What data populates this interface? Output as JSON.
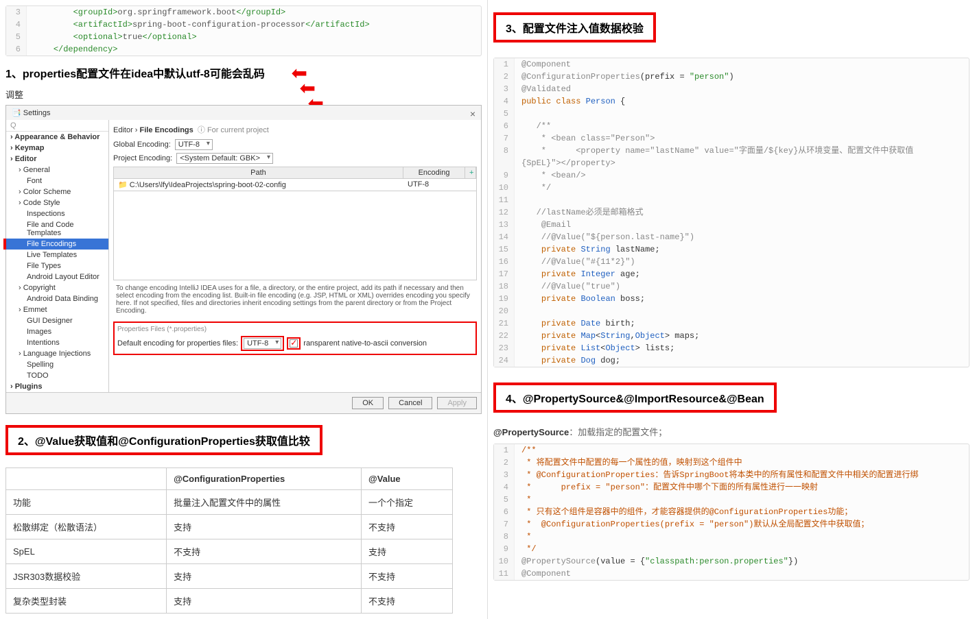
{
  "left": {
    "code1": [
      {
        "n": 3,
        "html": "        <span class='t-tag'>&lt;groupId&gt;</span><span class='t-text'>org.springframework.boot</span><span class='t-tag'>&lt;/groupId&gt;</span>"
      },
      {
        "n": 4,
        "html": "        <span class='t-tag'>&lt;artifactId&gt;</span><span class='t-text'>spring-boot-configuration-processor</span><span class='t-tag'>&lt;/artifactId&gt;</span>"
      },
      {
        "n": 5,
        "html": "        <span class='t-tag'>&lt;optional&gt;</span><span class='t-text'>true</span><span class='t-tag'>&lt;/optional&gt;</span>"
      },
      {
        "n": 6,
        "html": "    <span class='t-tag'>&lt;/dependency&gt;</span>"
      }
    ],
    "h1": "1、properties配置文件在idea中默认utf-8可能会乱码",
    "adjust": "调整",
    "settings": {
      "title": "Settings",
      "search_ph": "Q",
      "tree": [
        {
          "lvl": 1,
          "label": "Appearance & Behavior"
        },
        {
          "lvl": 1,
          "label": "Keymap"
        },
        {
          "lvl": 1,
          "label": "Editor",
          "open": true
        },
        {
          "lvl": 2,
          "label": "General"
        },
        {
          "lvl": 3,
          "label": "Font"
        },
        {
          "lvl": 2,
          "label": "Color Scheme"
        },
        {
          "lvl": 2,
          "label": "Code Style"
        },
        {
          "lvl": 3,
          "label": "Inspections"
        },
        {
          "lvl": 3,
          "label": "File and Code Templates"
        },
        {
          "lvl": 3,
          "label": "File Encodings",
          "sel": true
        },
        {
          "lvl": 3,
          "label": "Live Templates"
        },
        {
          "lvl": 3,
          "label": "File Types"
        },
        {
          "lvl": 3,
          "label": "Android Layout Editor"
        },
        {
          "lvl": 2,
          "label": "Copyright"
        },
        {
          "lvl": 3,
          "label": "Android Data Binding"
        },
        {
          "lvl": 2,
          "label": "Emmet"
        },
        {
          "lvl": 3,
          "label": "GUI Designer"
        },
        {
          "lvl": 3,
          "label": "Images"
        },
        {
          "lvl": 3,
          "label": "Intentions"
        },
        {
          "lvl": 2,
          "label": "Language Injections"
        },
        {
          "lvl": 3,
          "label": "Spelling"
        },
        {
          "lvl": 3,
          "label": "TODO"
        },
        {
          "lvl": 1,
          "label": "Plugins"
        }
      ],
      "crumb_editor": "Editor",
      "crumb_fe": "File Encodings",
      "crumb_scope": "For current project",
      "global_label": "Global Encoding:",
      "global_val": "UTF-8",
      "project_label": "Project Encoding:",
      "project_val": "<System Default: GBK>",
      "path_hdr": "Path",
      "enc_hdr": "Encoding",
      "path_val": "C:\\Users\\lfy\\IdeaProjects\\spring-boot-02-config",
      "enc_val": "UTF-8",
      "desc": "To change encoding IntelliJ IDEA uses for a file, a directory, or the entire project, add its path if necessary and then select encoding from the encoding list. Built-in file encoding (e.g. JSP, HTML or XML) overrides encoding you specify here. If not specified, files and directories inherit encoding settings from the parent directory or from the Project Encoding.",
      "prop_hdr": "Properties Files (*.properties)",
      "prop_label": "Default encoding for properties files:",
      "prop_val": "UTF-8",
      "prop_check": "ransparent native-to-ascii conversion",
      "ok": "OK",
      "cancel": "Cancel",
      "apply": "Apply"
    },
    "h2": "2、@Value获取值和@ConfigurationProperties获取值比较",
    "table": {
      "head": [
        "",
        "@ConfigurationProperties",
        "@Value"
      ],
      "rows": [
        [
          "功能",
          "批量注入配置文件中的属性",
          "一个个指定"
        ],
        [
          "松散绑定（松散语法）",
          "支持",
          "不支持"
        ],
        [
          "SpEL",
          "不支持",
          "支持"
        ],
        [
          "JSR303数据校验",
          "支持",
          "不支持"
        ],
        [
          "复杂类型封装",
          "支持",
          "不支持"
        ]
      ]
    }
  },
  "right": {
    "h3": "3、配置文件注入值数据校验",
    "code2": [
      {
        "n": 1,
        "html": "<span class='t-anno'>@Component</span>"
      },
      {
        "n": 2,
        "html": "<span class='t-anno'>@ConfigurationProperties</span>(prefix = <span class='t-str'>\"person\"</span>)"
      },
      {
        "n": 3,
        "html": "<span class='t-anno'>@Validated</span>"
      },
      {
        "n": 4,
        "html": "<span class='t-kw'>public</span> <span class='t-kw'>class</span> <span class='t-class'>Person</span> {"
      },
      {
        "n": 5,
        "html": ""
      },
      {
        "n": 6,
        "html": "   <span class='t-comment'>/**</span>"
      },
      {
        "n": 7,
        "html": "   <span class='t-comment'> * &lt;bean class=\"Person\"&gt;</span>"
      },
      {
        "n": 8,
        "html": "   <span class='t-comment'> *      &lt;property name=\"lastName\" value=\"字面量/${key}从环境变量、配置文件中获取值</span>"
      },
      {
        "n": "",
        "html": "<span class='t-comment'>{SpEL}\"&gt;&lt;/property&gt;</span>"
      },
      {
        "n": 9,
        "html": "   <span class='t-comment'> * &lt;bean/&gt;</span>"
      },
      {
        "n": 10,
        "html": "   <span class='t-comment'> */</span>"
      },
      {
        "n": 11,
        "html": ""
      },
      {
        "n": 12,
        "html": "   <span class='t-comment'>//lastName必须是邮箱格式</span>"
      },
      {
        "n": 13,
        "html": "    <span class='t-anno'>@Email</span>"
      },
      {
        "n": 14,
        "html": "    <span class='t-comment'>//@Value(\"${person.last-name}\")</span>"
      },
      {
        "n": 15,
        "html": "    <span class='t-kw'>private</span> <span class='t-class'>String</span> lastName;"
      },
      {
        "n": 16,
        "html": "    <span class='t-comment'>//@Value(\"#{11*2}\")</span>"
      },
      {
        "n": 17,
        "html": "    <span class='t-kw'>private</span> <span class='t-class'>Integer</span> age;"
      },
      {
        "n": 18,
        "html": "    <span class='t-comment'>//@Value(\"true\")</span>"
      },
      {
        "n": 19,
        "html": "    <span class='t-kw'>private</span> <span class='t-class'>Boolean</span> boss;"
      },
      {
        "n": 20,
        "html": ""
      },
      {
        "n": 21,
        "html": "    <span class='t-kw'>private</span> <span class='t-class'>Date</span> birth;"
      },
      {
        "n": 22,
        "html": "    <span class='t-kw'>private</span> <span class='t-class'>Map</span>&lt;<span class='t-class'>String</span>,<span class='t-class'>Object</span>&gt; maps;"
      },
      {
        "n": 23,
        "html": "    <span class='t-kw'>private</span> <span class='t-class'>List</span>&lt;<span class='t-class'>Object</span>&gt; lists;"
      },
      {
        "n": 24,
        "html": "    <span class='t-kw'>private</span> <span class='t-class'>Dog</span> dog;"
      }
    ],
    "h4": "4、@PropertySource&@ImportResource&@Bean",
    "psource": "@PropertySource：加载指定的配置文件；",
    "code3": [
      {
        "n": 1,
        "html": "<span class='t-comment-or'>/**</span>"
      },
      {
        "n": 2,
        "html": "<span class='t-comment-or'> * 将配置文件中配置的每一个属性的值，映射到这个组件中</span>"
      },
      {
        "n": 3,
        "html": "<span class='t-comment-or'> * @ConfigurationProperties：告诉SpringBoot将本类中的所有属性和配置文件中相关的配置进行绑</span>"
      },
      {
        "n": 4,
        "html": "<span class='t-comment-or'> *      prefix = \"person\"：配置文件中哪个下面的所有属性进行一一映射</span>"
      },
      {
        "n": 5,
        "html": "<span class='t-comment-or'> *</span>"
      },
      {
        "n": 6,
        "html": "<span class='t-comment-or'> * 只有这个组件是容器中的组件，才能容器提供的@ConfigurationProperties功能；</span>"
      },
      {
        "n": 7,
        "html": "<span class='t-comment-or'> *  @ConfigurationProperties(prefix = \"person\")默认从全局配置文件中获取值；</span>"
      },
      {
        "n": 8,
        "html": "<span class='t-comment-or'> *</span>"
      },
      {
        "n": 9,
        "html": "<span class='t-comment-or'> */</span>"
      },
      {
        "n": 10,
        "html": "<span class='t-anno'>@PropertySource</span>(value = {<span class='t-str'>\"classpath:person.properties\"</span>})"
      },
      {
        "n": 11,
        "html": "<span class='t-anno'>@Component</span>"
      }
    ]
  }
}
